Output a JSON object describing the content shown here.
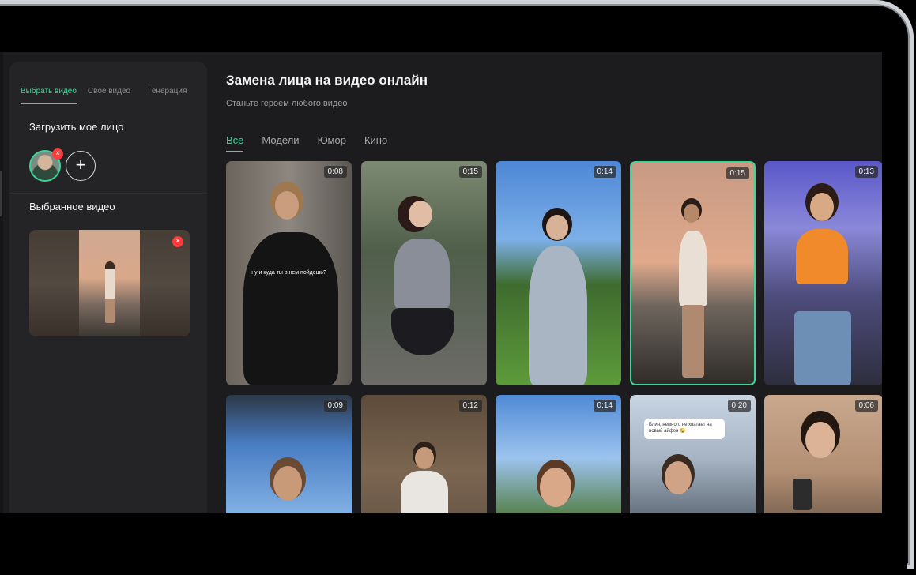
{
  "left_panel": {
    "tabs": [
      {
        "label": "Выбрать видео",
        "active": true
      },
      {
        "label": "Своё видео",
        "active": false
      },
      {
        "label": "Генерация",
        "active": false
      }
    ],
    "upload_title": "Загрузить мое лицо",
    "selected_title": "Выбранное видео",
    "remove_icon": "×",
    "add_icon": "+"
  },
  "main": {
    "title": "Замена лица на видео онлайн",
    "subtitle": "Станьте героем любого видео",
    "categories": [
      {
        "label": "Все",
        "active": true
      },
      {
        "label": "Модели",
        "active": false
      },
      {
        "label": "Юмор",
        "active": false
      },
      {
        "label": "Кино",
        "active": false
      }
    ],
    "videos_row1": [
      {
        "duration": "0:08",
        "caption": "ну и куда ты в нем пойдешь?"
      },
      {
        "duration": "0:15"
      },
      {
        "duration": "0:14"
      },
      {
        "duration": "0:15",
        "selected": true
      },
      {
        "duration": "0:13"
      }
    ],
    "videos_row2": [
      {
        "duration": "0:09"
      },
      {
        "duration": "0:12"
      },
      {
        "duration": "0:14"
      },
      {
        "duration": "0:20",
        "caption": "Блин, немного не хватает на новый айфон 😉"
      },
      {
        "duration": "0:06"
      }
    ]
  },
  "colors": {
    "accent": "#3dd598",
    "remove": "#ff3b3b",
    "panel": "#242426",
    "bg": "#1c1c1e"
  }
}
